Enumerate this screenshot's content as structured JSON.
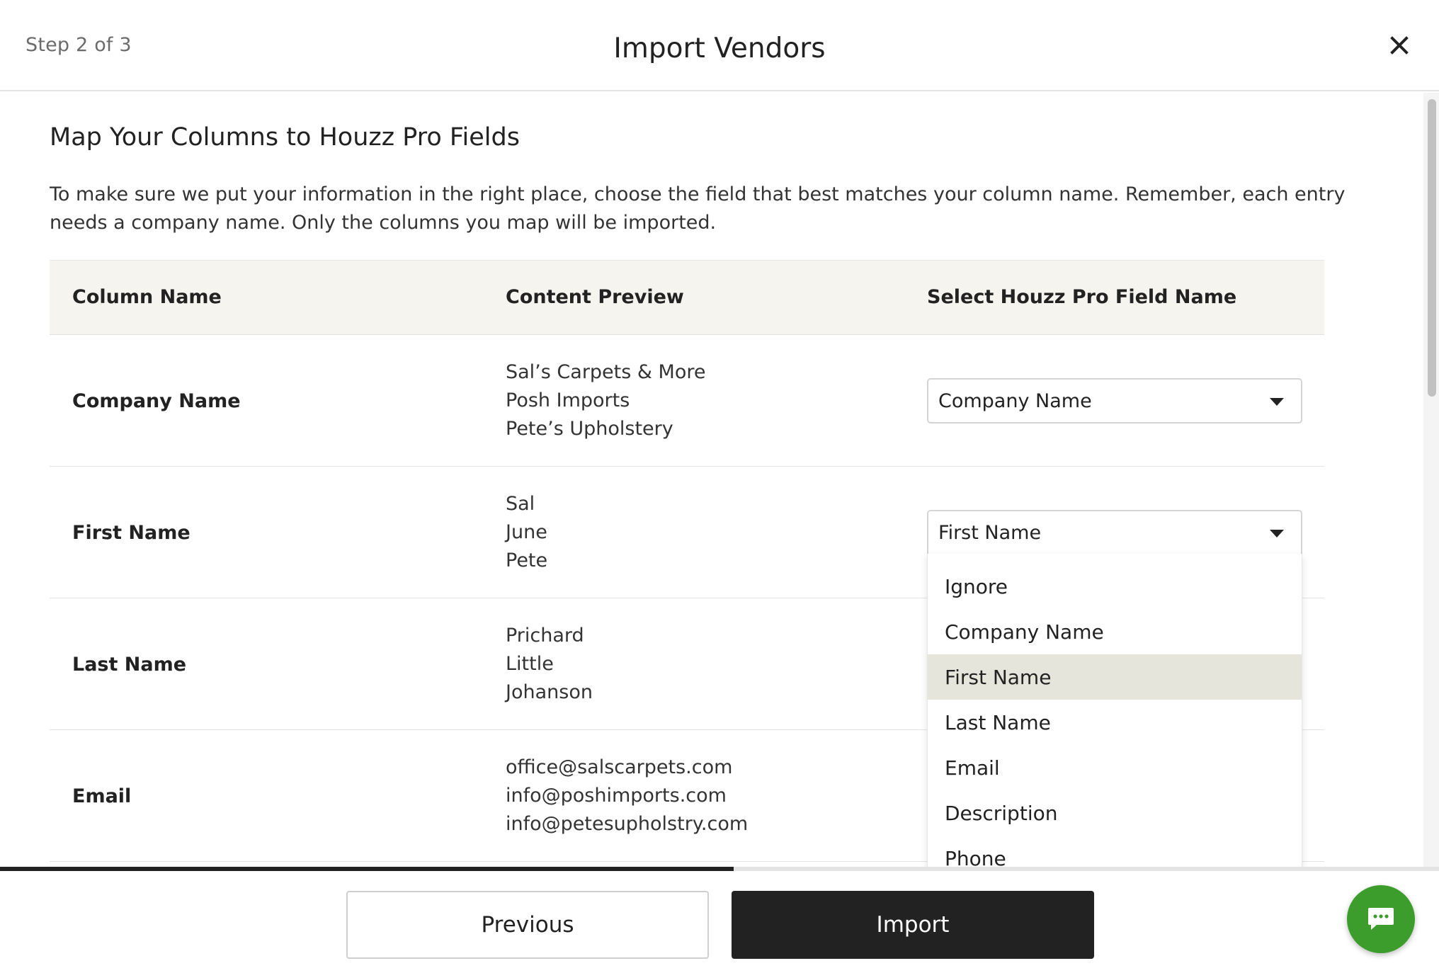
{
  "header": {
    "step": "Step 2 of 3",
    "title": "Import Vendors",
    "close_icon": "close-icon"
  },
  "main": {
    "section_title": "Map Your Columns to Houzz Pro Fields",
    "intro": "To make sure we put your information in the right place, choose the field that best matches your column name. Remember, each entry needs a company name. Only the columns you map will be imported.",
    "columns": [
      "Column Name",
      "Content Preview",
      "Select Houzz Pro Field Name"
    ],
    "rows": [
      {
        "name": "Company Name",
        "preview": [
          "Sal’s Carpets & More",
          "Posh Imports",
          "Pete’s Upholstery"
        ],
        "field": "Company Name"
      },
      {
        "name": "First Name",
        "preview": [
          "Sal",
          "June",
          "Pete"
        ],
        "field": "First Name"
      },
      {
        "name": "Last Name",
        "preview": [
          "Prichard",
          "Little",
          "Johanson"
        ],
        "field": ""
      },
      {
        "name": "Email",
        "preview": [
          "office@salscarpets.com",
          "info@poshimports.com",
          "info@petesupholstry.com"
        ],
        "field": ""
      }
    ],
    "dropdown": {
      "options": [
        "Ignore",
        "Company Name",
        "First Name",
        "Last Name",
        "Email",
        "Description",
        "Phone"
      ],
      "selected": "First Name"
    }
  },
  "progress": {
    "value": 0.51
  },
  "footer": {
    "previous_label": "Previous",
    "import_label": "Import",
    "chat_icon": "chat-icon"
  },
  "colors": {
    "accent_dark": "#222222",
    "chat_green": "#3c9d2c",
    "header_row_bg": "#f5f4ef",
    "selected_option_bg": "#e6e5dc"
  }
}
